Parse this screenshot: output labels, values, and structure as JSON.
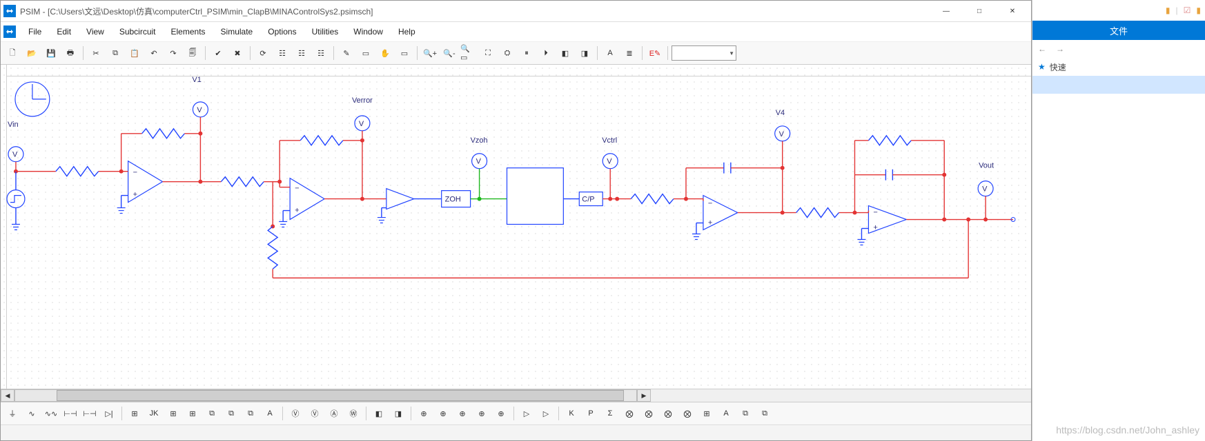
{
  "window": {
    "app_name": "PSIM",
    "title": "PSIM - [C:\\Users\\文远\\Desktop\\仿真\\computerCtrl_PSIM\\min_ClapB\\MINAControlSys2.psimsch]"
  },
  "menus": [
    "File",
    "Edit",
    "View",
    "Subcircuit",
    "Elements",
    "Simulate",
    "Options",
    "Utilities",
    "Window",
    "Help"
  ],
  "toolbar_dropdown_value": "",
  "schematic_labels": {
    "Vin": "Vin",
    "V1": "V1",
    "Verror": "Verror",
    "Vzoh": "Vzoh",
    "Vctrl": "Vctrl",
    "V4": "V4",
    "Vout": "Vout",
    "ZOH": "ZOH",
    "CP": "C/P"
  },
  "side_panel": {
    "tab": "文件",
    "quick": "快速",
    "nav_back": "←",
    "nav_fwd": "→"
  },
  "watermark": "https://blog.csdn.net/John_ashley",
  "chart_data": {
    "type": "diagram",
    "description": "PSIM analog/digital control schematic (non-numeric circuit diagram)",
    "nodes": [
      {
        "id": "Vin",
        "kind": "voltage-probe",
        "label": "Vin"
      },
      {
        "id": "step",
        "kind": "step-source"
      },
      {
        "id": "clock",
        "kind": "sim-clock"
      },
      {
        "id": "R1",
        "kind": "resistor"
      },
      {
        "id": "opamp1",
        "kind": "opamp"
      },
      {
        "id": "V1",
        "kind": "voltage-probe",
        "label": "V1"
      },
      {
        "id": "Rfb1",
        "kind": "resistor"
      },
      {
        "id": "R2",
        "kind": "resistor"
      },
      {
        "id": "opamp2",
        "kind": "opamp"
      },
      {
        "id": "Verror",
        "kind": "voltage-probe",
        "label": "Verror"
      },
      {
        "id": "Rfb2",
        "kind": "resistor"
      },
      {
        "id": "Rfb3",
        "kind": "resistor"
      },
      {
        "id": "buf",
        "kind": "buffer"
      },
      {
        "id": "ZOH",
        "kind": "zoh-block",
        "label": "ZOH"
      },
      {
        "id": "Vzoh",
        "kind": "voltage-probe",
        "label": "Vzoh"
      },
      {
        "id": "plant",
        "kind": "subsystem-block"
      },
      {
        "id": "CP",
        "kind": "cp-block",
        "label": "C/P"
      },
      {
        "id": "Vctrl",
        "kind": "voltage-probe",
        "label": "Vctrl"
      },
      {
        "id": "R3",
        "kind": "resistor"
      },
      {
        "id": "opamp3",
        "kind": "opamp"
      },
      {
        "id": "C1",
        "kind": "capacitor"
      },
      {
        "id": "V4",
        "kind": "voltage-probe",
        "label": "V4"
      },
      {
        "id": "R4",
        "kind": "resistor"
      },
      {
        "id": "opamp4",
        "kind": "opamp"
      },
      {
        "id": "C2",
        "kind": "capacitor"
      },
      {
        "id": "Rfb4",
        "kind": "resistor"
      },
      {
        "id": "Vout",
        "kind": "voltage-probe",
        "label": "Vout"
      }
    ],
    "feedback": "Vout node wired back (red) through bottom rail and vertical resistor into opamp2 summing node"
  }
}
